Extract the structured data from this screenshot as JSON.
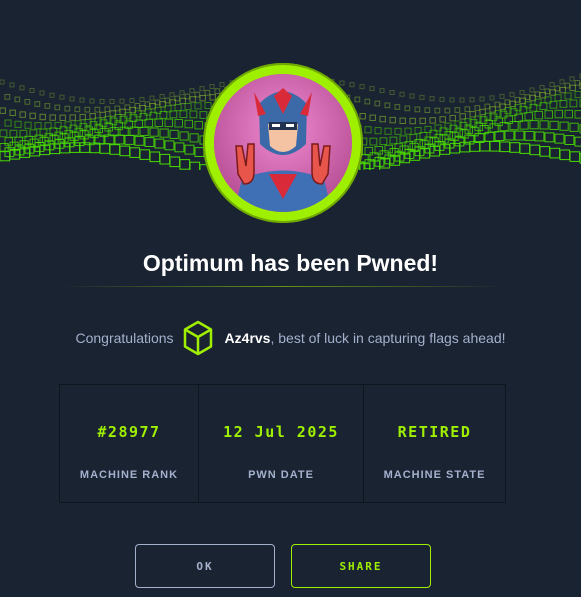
{
  "dialog": {
    "title": "Optimum has been Pwned!",
    "congrats_prefix": "Congratulations",
    "username": "Az4rvs",
    "congrats_suffix": ", best of luck in capturing flags ahead!"
  },
  "stats": [
    {
      "value": "#28977",
      "label": "MACHINE RANK"
    },
    {
      "value": "12 Jul 2025",
      "label": "PWN DATE"
    },
    {
      "value": "RETIRED",
      "label": "MACHINE STATE"
    }
  ],
  "buttons": {
    "ok": "OK",
    "share": "SHARE"
  },
  "colors": {
    "background": "#1a2332",
    "accent": "#9fef00",
    "muted_text": "#a4b1cd"
  },
  "icons": {
    "banner": "green-cube-wave-banner",
    "avatar": "superhero-avatar",
    "user_badge": "hexagon-cube-icon"
  }
}
